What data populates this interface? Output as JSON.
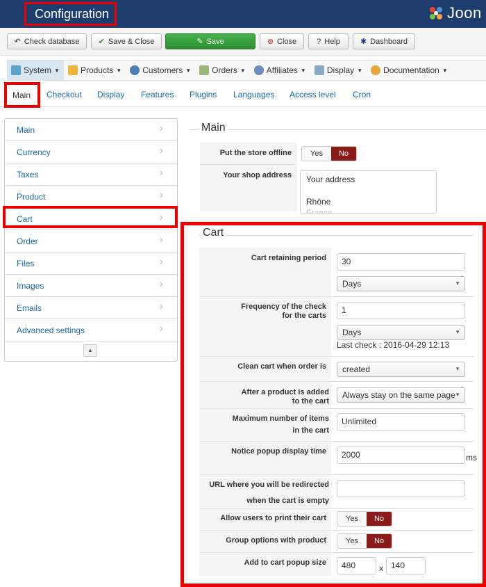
{
  "header": {
    "title": "Configuration",
    "brand": "Joon"
  },
  "toolbar": {
    "check_database": "Check database",
    "save_close": "Save & Close",
    "save": "Save",
    "close": "Close",
    "help": "Help",
    "dashboard": "Dashboard"
  },
  "menubar": {
    "items": [
      "System",
      "Products",
      "Customers",
      "Orders",
      "Affiliates",
      "Display",
      "Documentation"
    ]
  },
  "tabs": [
    "Main",
    "Checkout",
    "Display",
    "Features",
    "Plugins",
    "Languages",
    "Access level",
    "Cron"
  ],
  "sidebar": {
    "items": [
      "Main",
      "Currency",
      "Taxes",
      "Product",
      "Cart",
      "Order",
      "Files",
      "Images",
      "Emails",
      "Advanced settings"
    ]
  },
  "main_section": {
    "legend": "Main",
    "offline_label": "Put the store offline",
    "yes": "Yes",
    "no": "No",
    "address_label": "Your shop address",
    "address_lines": [
      "Your address",
      "",
      "Rhône",
      "France"
    ]
  },
  "cart_section": {
    "legend": "Cart",
    "retaining_label": "Cart retaining period",
    "retaining_value": "30",
    "retaining_unit": "Days",
    "frequency_label_1": "Frequency of the check",
    "frequency_label_2": "for the carts",
    "frequency_value": "1",
    "frequency_unit": "Days",
    "last_check": "Last check : 2016-04-29 12:13",
    "clean_label": "Clean cart when order is",
    "clean_value": "created",
    "after_added_label_1": "After a product is added",
    "after_added_label_2": "to the cart",
    "after_added_value": "Always stay on the same page",
    "max_items_label_1": "Maximum number of items",
    "max_items_label_2": "in the cart",
    "max_items_value": "Unlimited",
    "notice_label": "Notice popup display time",
    "notice_value": "2000",
    "notice_unit": "ms",
    "url_label_1": "URL where you will be redirected",
    "url_label_2": "when the cart is empty",
    "url_value": "",
    "print_label": "Allow users to print their cart",
    "group_label": "Group options with product",
    "popup_size_label": "Add to cart popup size",
    "popup_width": "480",
    "popup_x": "x",
    "popup_height": "140"
  }
}
